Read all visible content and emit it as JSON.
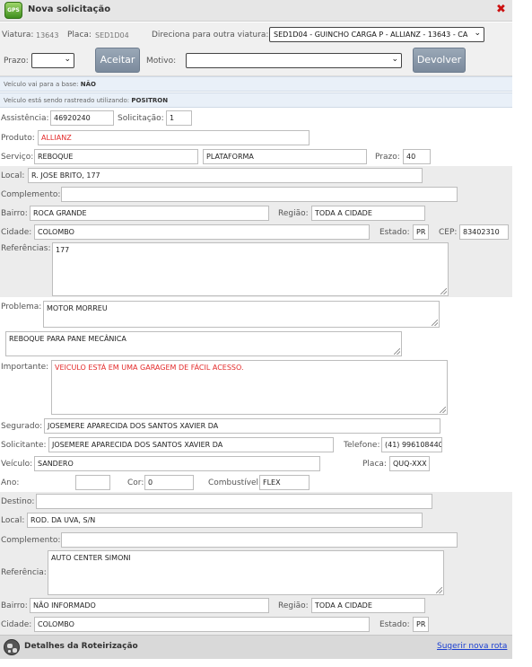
{
  "header": {
    "title": "Nova solicitação",
    "logo_text": "GPS"
  },
  "vehicle": {
    "viatura_label": "Viatura:",
    "viatura_value": "13643",
    "placa_label": "Placa:",
    "placa_value": "SED1D04",
    "redirect_label": "Direciona para outra viatura:",
    "redirect_value": "SED1D04 - GUINCHO CARGA P - ALLIANZ - 13643 - CA"
  },
  "actions": {
    "prazo_label": "Prazo:",
    "prazo_value": "",
    "aceitar_label": "Aceitar",
    "motivo_label": "Motivo:",
    "motivo_value": "",
    "devolver_label": "Devolver"
  },
  "info": {
    "base_label": "Veículo vai para a base:",
    "base_value": "NÃO",
    "tracking_label": "Veículo está sendo rastreado utilizando:",
    "tracking_value": "POSITRON"
  },
  "form": {
    "assistencia_label": "Assistência:",
    "assistencia": "46920240",
    "solicitacao_label": "Solicitação:",
    "solicitacao": "1",
    "produto_label": "Produto:",
    "produto": "ALLIANZ",
    "servico_label": "Serviço:",
    "servico": "REBOQUE",
    "servico2": "PLATAFORMA",
    "prazo_label": "Prazo:",
    "prazo": "40",
    "local_label": "Local:",
    "local": "R. JOSE BRITO, 177",
    "complemento_label": "Complemento:",
    "complemento": "",
    "bairro_label": "Bairro:",
    "bairro": "ROCA GRANDE",
    "regiao_label": "Região:",
    "regiao": "TODA A CIDADE",
    "cidade_label": "Cidade:",
    "cidade": "COLOMBO",
    "estado_label": "Estado:",
    "estado": "PR",
    "cep_label": "CEP:",
    "cep": "83402310",
    "referencias_label": "Referências:",
    "referencias": "177",
    "problema_label": "Problema:",
    "problema": "MOTOR MORREU",
    "problema2": "REBOQUE PARA PANE MECÂNICA",
    "importante_label": "Importante:",
    "importante": "VEICULO ESTÁ EM UMA GARAGEM DE FÁCIL ACESSO.",
    "segurado_label": "Segurado:",
    "segurado": "JOSEMERE APARECIDA DOS SANTOS XAVIER DA",
    "solicitante_label": "Solicitante:",
    "solicitante": "JOSEMERE APARECIDA DOS SANTOS XAVIER DA",
    "telefone_label": "Telefone:",
    "telefone": "(41) 996108440",
    "veiculo_label": "Veículo:",
    "veiculo": "SANDERO",
    "placa_label": "Placa:",
    "placa": "QUQ-XXX",
    "ano_label": "Ano:",
    "ano": "",
    "cor_label": "Cor:",
    "cor": "0",
    "combustivel_label": "Combustível:",
    "combustivel": "FLEX"
  },
  "destino": {
    "destino_label": "Destino:",
    "destino": "",
    "local_label": "Local:",
    "local": "ROD. DA UVA, S/N",
    "complemento_label": "Complemento:",
    "complemento": "",
    "referencia_label": "Referência:",
    "referencia": "AUTO CENTER SIMONI",
    "bairro_label": "Bairro:",
    "bairro": "NÃO INFORMADO",
    "regiao_label": "Região:",
    "regiao": "TODA A CIDADE",
    "cidade_label": "Cidade:",
    "cidade": "COLOMBO",
    "estado_label": "Estado:",
    "estado": "PR"
  },
  "footer": {
    "title": "Detalhes da Roteirização",
    "link": "Sugerir nova rota"
  },
  "colors": {
    "accent_red": "#e32a2a",
    "link_blue": "#1a3ed1",
    "button": "#8896a6",
    "info_bg": "#e9f0f8"
  }
}
